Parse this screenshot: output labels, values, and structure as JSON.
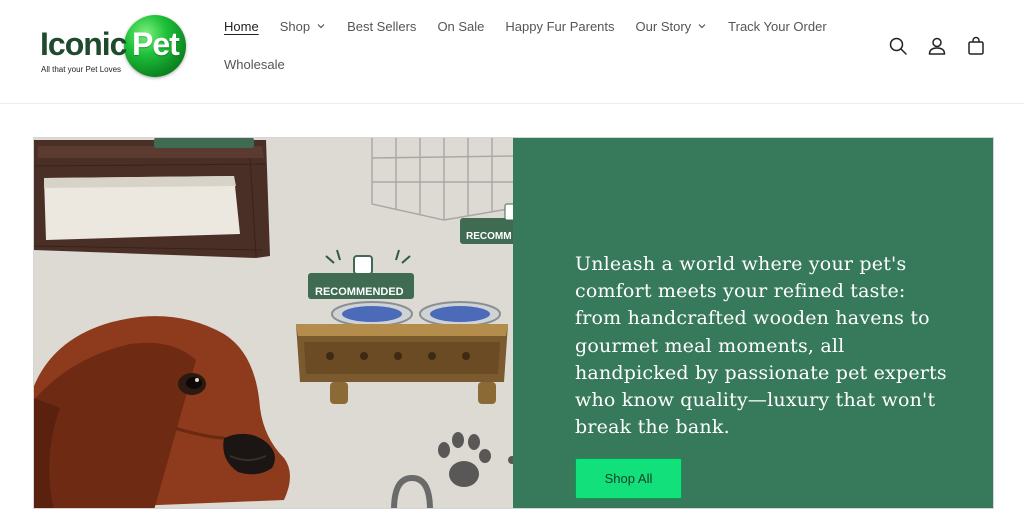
{
  "logo": {
    "text_left": "Iconic",
    "text_right": "Pet",
    "tagline": "All that your  Pet Loves"
  },
  "nav": {
    "row1": [
      {
        "label": "Home",
        "active": true,
        "dropdown": false
      },
      {
        "label": "Shop",
        "active": false,
        "dropdown": true
      },
      {
        "label": "Best Sellers",
        "active": false,
        "dropdown": false
      },
      {
        "label": "On Sale",
        "active": false,
        "dropdown": false
      },
      {
        "label": "Happy Fur Parents",
        "active": false,
        "dropdown": false
      },
      {
        "label": "Our Story",
        "active": false,
        "dropdown": true
      },
      {
        "label": "Track Your Order",
        "active": false,
        "dropdown": false
      }
    ],
    "row2": [
      {
        "label": "Wholesale",
        "active": false,
        "dropdown": false
      }
    ]
  },
  "header_icons": [
    "search-icon",
    "account-icon",
    "cart-icon"
  ],
  "hero": {
    "text": "Unleash a world where your pet's comfort meets your refined taste: from handcrafted wooden havens to gourmet meal moments, all handpicked by passionate pet experts who know quality—luxury that won't break the bank.",
    "button_label": "Shop All",
    "badge_label": "RECOMMENDED",
    "badge_label_short": "RECOMM",
    "panel_color": "#377a5b",
    "button_color": "#12e07a"
  }
}
